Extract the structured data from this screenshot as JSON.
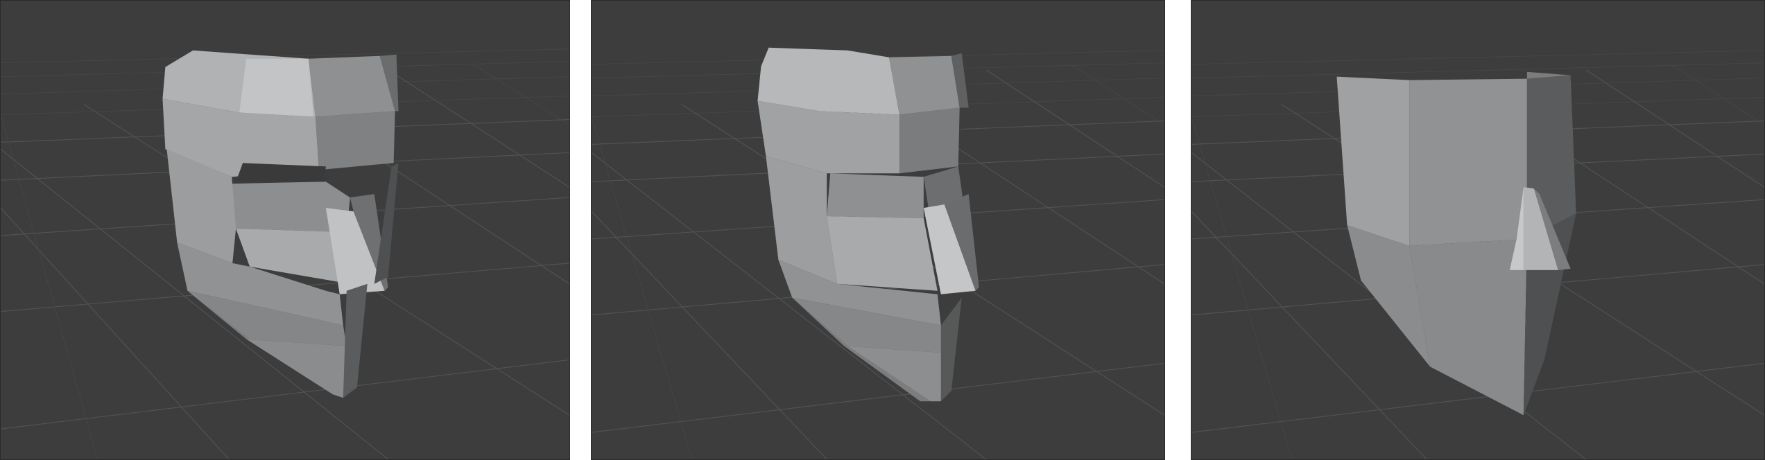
{
  "viewports": [
    {
      "id": "viewport-1",
      "model": "low-poly-head-mask-angled"
    },
    {
      "id": "viewport-2",
      "model": "low-poly-head-mask-front-angled"
    },
    {
      "id": "viewport-3",
      "model": "low-poly-head-block-side"
    }
  ],
  "colors": {
    "background": "#3d3d3d",
    "grid": "#525252",
    "mesh_light": "#b4b6b7",
    "mesh_mid": "#9a9c9d",
    "mesh_dark": "#6e7071",
    "mesh_shadow": "#4e5051",
    "separator": "#ffffff"
  }
}
